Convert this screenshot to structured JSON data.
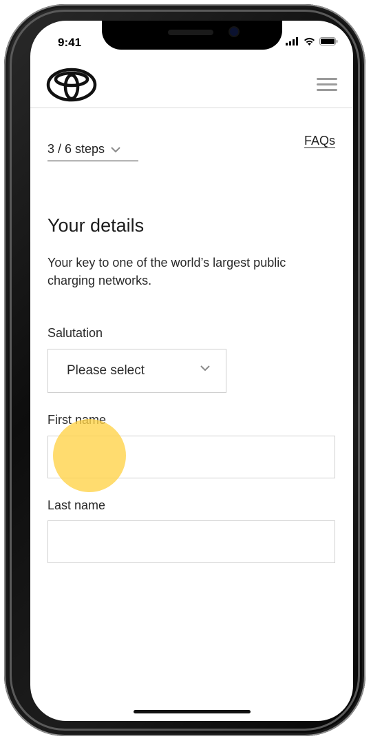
{
  "status_bar": {
    "time": "9:41"
  },
  "header": {
    "logo_icon": "toyota-logo-icon",
    "menu_icon": "hamburger-menu-icon"
  },
  "progress": {
    "steps_label": "3 / 6 steps",
    "current_step": 3,
    "total_steps": 6
  },
  "faq": {
    "label": "FAQs"
  },
  "form": {
    "title": "Your details",
    "subtitle": "Your key to one of the world’s largest public charging networks.",
    "salutation": {
      "label": "Salutation",
      "selected": "Please select"
    },
    "first_name": {
      "label": "First name",
      "value": ""
    },
    "last_name": {
      "label": "Last name",
      "value": ""
    }
  },
  "colors": {
    "touch_indicator": "#FFD246",
    "text": "#222222",
    "border": "#CFCFCF"
  }
}
